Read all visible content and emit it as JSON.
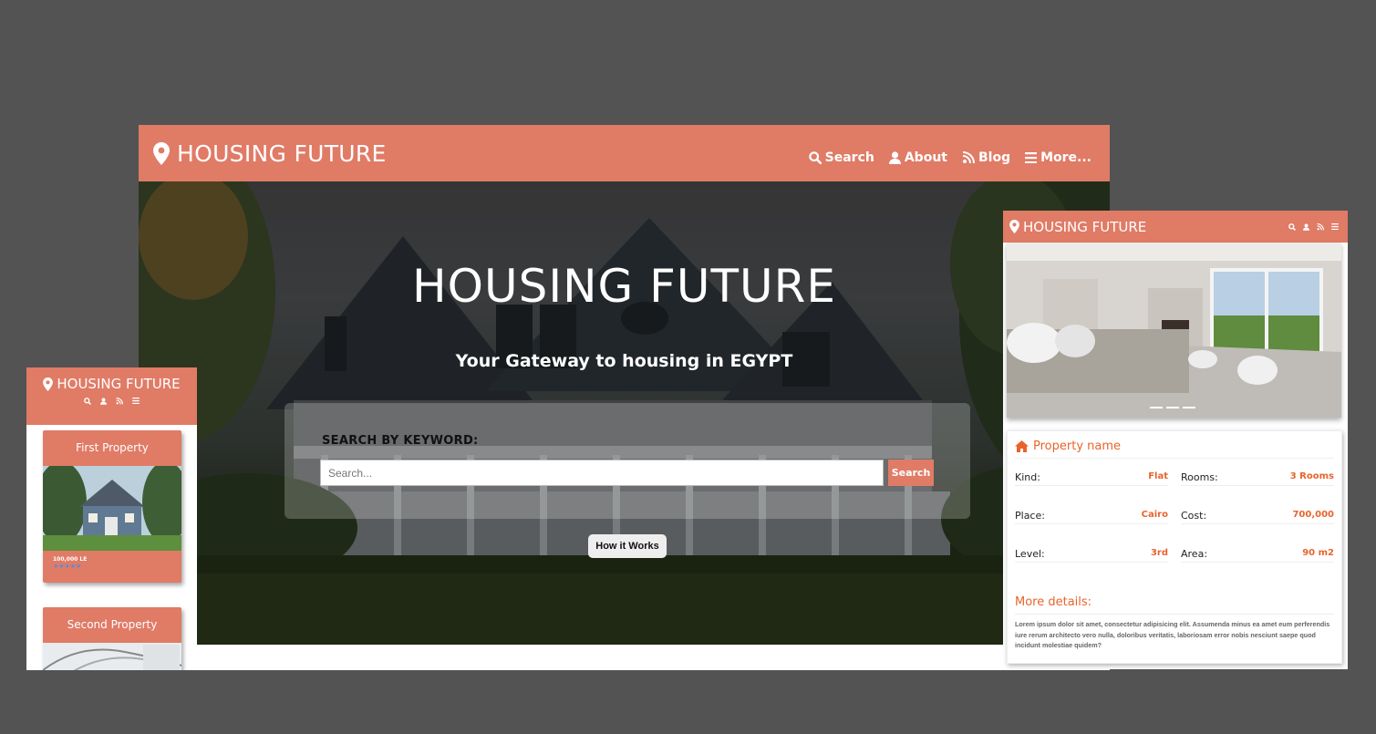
{
  "desktop": {
    "brand": "HOUSING FUTURE",
    "nav": [
      {
        "icon": "search-icon",
        "label": "Search"
      },
      {
        "icon": "user-icon",
        "label": "About"
      },
      {
        "icon": "rss-icon",
        "label": "Blog"
      },
      {
        "icon": "menu-icon",
        "label": "More..."
      }
    ],
    "hero_title": "HOUSING FUTURE",
    "hero_subtitle": "Your Gateway to housing in EGYPT",
    "search_label": "SEARCH BY KEYWORD:",
    "search_placeholder": "Search...",
    "search_button": "Search",
    "how_button": "How it Works"
  },
  "left_phone": {
    "brand": "HOUSING FUTURE",
    "cards": [
      {
        "title": "First Property",
        "price": "100,000 LE",
        "stars": "★★★★★"
      },
      {
        "title": "Second Property"
      }
    ]
  },
  "right_phone": {
    "brand": "HOUSING FUTURE",
    "property_name": "Property name",
    "specs": [
      {
        "key": "Kind:",
        "value": "Flat"
      },
      {
        "key": "Rooms:",
        "value": "3 Rooms"
      },
      {
        "key": "Place:",
        "value": "Cairo"
      },
      {
        "key": "Cost:",
        "value": "700,000"
      },
      {
        "key": "Level:",
        "value": "3rd"
      },
      {
        "key": "Area:",
        "value": "90 m2"
      }
    ],
    "more_title": "More details:",
    "more_text": "Lorem ipsum dolor sit amet, consectetur adipisicing elit. Assumenda minus ea amet eum perferendis iure rerum architecto vero nulla, doloribus veritatis, laboriosam error nobis nesciunt saepe quod incidunt molestiae quidem?"
  },
  "colors": {
    "accent": "#e07b66",
    "highlight": "#e8642c",
    "backdrop": "#535353"
  }
}
